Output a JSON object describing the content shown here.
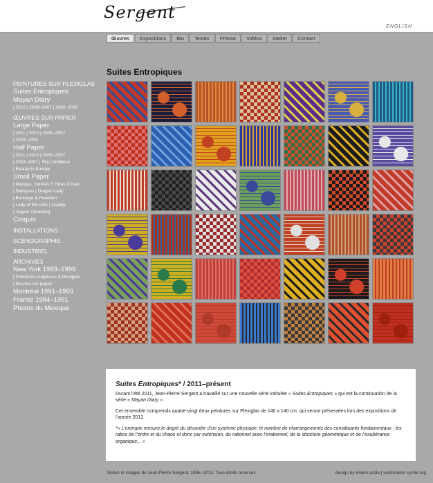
{
  "header": {
    "logo": "Sergent",
    "lang": "ENGLISH"
  },
  "nav": [
    "Œuvres",
    "Expositions",
    "Bio",
    "Textes",
    "Presse",
    "Vidéos",
    "Atelier",
    "Contact"
  ],
  "page_title": "Suites Entropiques",
  "sidebar": [
    {
      "t": "sec",
      "v": "PEINTURES SUR PLEXIGLAS"
    },
    {
      "t": "item",
      "v": "Suites Entropiques"
    },
    {
      "t": "item",
      "v": "Mayan Diary"
    },
    {
      "t": "sub",
      "v": "| 2010 | 2008–2007 | 2002–2000"
    },
    {
      "t": "gap"
    },
    {
      "t": "sec",
      "v": "ŒUVRES SUR PAPIER"
    },
    {
      "t": "item",
      "v": "Large Paper"
    },
    {
      "t": "sub",
      "v": "| 2011 | 2010 | 2008–2007"
    },
    {
      "t": "sub",
      "v": "| 2003–2000"
    },
    {
      "t": "item",
      "v": "Half Paper"
    },
    {
      "t": "sub",
      "v": "| 2011 | 2010 | 2009–2007"
    },
    {
      "t": "sub",
      "v": "| 2003–1997 | Sky Umbilicus"
    },
    {
      "t": "sub",
      "v": "| Beauty Is Energy"
    },
    {
      "t": "item",
      "v": "Small Paper"
    },
    {
      "t": "sub",
      "v": "| Mangas, Yantras Y Otras Cosas"
    },
    {
      "t": "sub",
      "v": "| Dionysos | Dragon Lady"
    },
    {
      "t": "sub",
      "v": "| Bondage & Freedom"
    },
    {
      "t": "sub",
      "v": "| Lady of the Ants | Duality"
    },
    {
      "t": "sub",
      "v": "| Jaguar Dreaming"
    },
    {
      "t": "item",
      "v": "Croquis"
    },
    {
      "t": "gap"
    },
    {
      "t": "sec",
      "v": "INSTALLATIONS"
    },
    {
      "t": "gap"
    },
    {
      "t": "sec",
      "v": "SCÉNOGRAPHIE"
    },
    {
      "t": "gap"
    },
    {
      "t": "sec",
      "v": "INDUSTRIEL"
    },
    {
      "t": "gap"
    },
    {
      "t": "sec",
      "v": "ARCHIVES"
    },
    {
      "t": "item",
      "v": "New York 1993–1999"
    },
    {
      "t": "sub",
      "v": "| Peintures-sculptures & Plexiglas"
    },
    {
      "t": "sub",
      "v": "| Œuvres sur papier"
    },
    {
      "t": "item",
      "v": "Montréal 1991–1993"
    },
    {
      "t": "item",
      "v": "France 1984–1991"
    },
    {
      "t": "item",
      "v": "Photos du Mexique"
    }
  ],
  "tiles": [
    [
      "#c0392b",
      "#2a4fa0"
    ],
    [
      "#1b1b3a",
      "#d2602a"
    ],
    [
      "#b8542a",
      "#e08a3c"
    ],
    [
      "#b03020",
      "#d9c09a"
    ],
    [
      "#5a2f8a",
      "#e4d24a"
    ],
    [
      "#4a5ab0",
      "#d8b040"
    ],
    [
      "#1f5a8a",
      "#39b5c0"
    ],
    [
      "#e07070",
      "#c03020"
    ],
    [
      "#2c5fb0",
      "#6fa0e0"
    ],
    [
      "#e0a020",
      "#c04020"
    ],
    [
      "#2a3a9a",
      "#e0a030"
    ],
    [
      "#2f6f4a",
      "#d05030"
    ],
    [
      "#1d1d1d",
      "#e0b020"
    ],
    [
      "#5a4aa0",
      "#e8e8e8"
    ],
    [
      "#c03a2a",
      "#e8e0d0"
    ],
    [
      "#222",
      "#4a4a4a"
    ],
    [
      "#eaeaea",
      "#5a3a7a"
    ],
    [
      "#6aa05a",
      "#3a4a9a"
    ],
    [
      "#c04a5a",
      "#e0b0b0"
    ],
    [
      "#d04a2a",
      "#1a1a1a"
    ],
    [
      "#c03a2a",
      "#e0a0a0"
    ],
    [
      "#d0b020",
      "#4a3a9a"
    ],
    [
      "#b03020",
      "#2a6a9a"
    ],
    [
      "#e0e0e0",
      "#9a2a2a"
    ],
    [
      "#2a6aa0",
      "#c03020"
    ],
    [
      "#c04020",
      "#e0e0e0"
    ],
    [
      "#b05030",
      "#d0a070"
    ],
    [
      "#d04030",
      "#3a3a3a"
    ],
    [
      "#7aa05a",
      "#4a3a9a"
    ],
    [
      "#d0b020",
      "#2a7a4a"
    ],
    [
      "#c04040",
      "#e07060"
    ],
    [
      "#e05040",
      "#b03030"
    ],
    [
      "#e0b020",
      "#1a1a1a"
    ],
    [
      "#1b1b1b",
      "#d0402a"
    ],
    [
      "#e08040",
      "#c03a2a"
    ],
    [
      "#a03020",
      "#d0a080"
    ],
    [
      "#c03020",
      "#e07050"
    ],
    [
      "#d04a3a",
      "#b03a2a"
    ],
    [
      "#3a7ad0",
      "#2a2a2a"
    ],
    [
      "#3a3a3a",
      "#c08040"
    ],
    [
      "#e05030",
      "#2a2a2a"
    ],
    [
      "#c03020",
      "#a02010"
    ]
  ],
  "text": {
    "title_italic": "Suites Entropiques",
    "title_rest": "* / 2011–présent",
    "p1a": "Durant l’été 2011, Jean-Pierre Sergent a travaillé sur une nouvelle série intitulée « ",
    "p1b": "Suites Entropiques",
    "p1c": " » qui est la continuation de la série « ",
    "p1d": "Mayan Diary",
    "p1e": " ».",
    "p2": "Cet ensemble comprends quatre-vingt deux peintures sur Plexiglas de 140 x 140 cm, qui seront présentées lors des expositions de l’année 2012.",
    "p3": "*« L’entropie mesure le degré du désordre d’un système physique; le nombre de réarrangements des constituants fondamentaux ; les ratios de l’ordre et du chaos et donc par extension, du rationnel avec l’irrationnel, de la structure géométrique et de l’exubérance organique... »"
  },
  "footer": {
    "left": "Textes et images de Jean-Pierre Sergent, 1996–2013. Tous droits réservés.",
    "right": "design by elaine scola | webmaster cyrcle.org"
  }
}
